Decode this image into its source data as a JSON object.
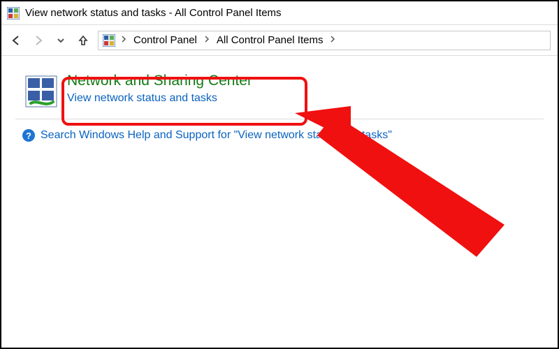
{
  "window": {
    "title": "View network status and tasks - All Control Panel Items"
  },
  "breadcrumbs": {
    "items": [
      "Control Panel",
      "All Control Panel Items"
    ]
  },
  "result": {
    "title": "Network and Sharing Center",
    "subtitle": "View network status and tasks",
    "icon_name": "network-sharing-center-icon"
  },
  "help": {
    "text": "Search Windows Help and Support for \"View network status and tasks\""
  },
  "annotations": {
    "highlighted": "Network and Sharing Center",
    "arrow_color": "#f01010"
  }
}
